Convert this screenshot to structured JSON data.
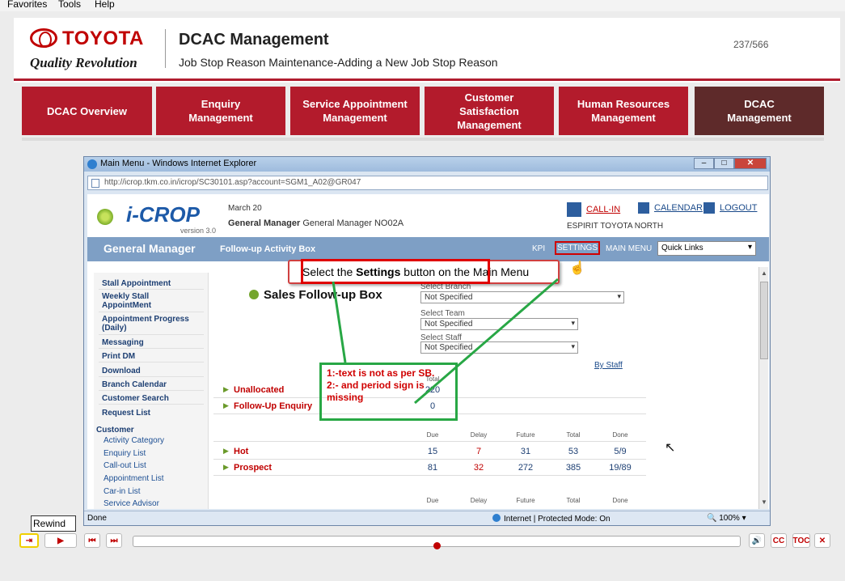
{
  "browser_menu": [
    "Favorites",
    "Tools",
    "Help"
  ],
  "header": {
    "expand_glyph": "»",
    "brand": "TOYOTA",
    "tagline": "Quality Revolution",
    "title": "DCAC Management",
    "subtitle": "Job Stop Reason Maintenance-Adding a New Job Stop Reason",
    "page_counter": "237/566"
  },
  "nav": {
    "tabs": [
      {
        "label": "DCAC Overview"
      },
      {
        "label": "Enquiry Management"
      },
      {
        "label": "Service Appointment Management"
      },
      {
        "label": "Customer Satisfaction Management"
      },
      {
        "label": "Human Resources Management"
      },
      {
        "label": "DCAC Management",
        "active": true
      }
    ]
  },
  "ie": {
    "title": "Main Menu  - Windows Internet Explorer",
    "address": "http://icrop.tkm.co.in/icrop/SC30101.asp?account=SGM1_A02@GR047",
    "status_left": "Done",
    "status_zone": "Internet | Protected Mode: On",
    "zoom": "100%"
  },
  "app": {
    "logo": "i-CROP",
    "version": "version 3.0",
    "date": "March 20",
    "user_role": "General Manager",
    "user_name": "General Manager NO02A",
    "links": {
      "callin": "CALL-IN",
      "calendar": "CALENDAR",
      "logout": "LOGOUT"
    },
    "dealer": "ESPIRIT TOYOTA NORTH",
    "band": {
      "role": "General Manager",
      "screen": "Follow-up Activity Box",
      "kpi": "KPI",
      "settings": "SETTINGS",
      "main_menu": "MAIN MENU",
      "quick_links": "Quick Links"
    },
    "sidebar": {
      "items": [
        "Stall Appointment",
        "Weekly Stall AppointMent",
        "Appointment Progress (Daily)",
        "Messaging",
        "Print DM",
        "Download",
        "Branch Calendar",
        "Customer Search",
        "Request List"
      ],
      "section": "Customer",
      "sub_items": [
        "Activity Category",
        "Enquiry List",
        "Call-out List",
        "Appointment List",
        "Car-in List",
        "Service Advisor"
      ]
    },
    "followup": {
      "title": "Sales Follow-up Box",
      "select_branch_label": "Select Branch",
      "select_branch_value": "Not Specified",
      "select_team_label": "Select Team",
      "select_team_value": "Not Specified",
      "select_staff_label": "Select Staff",
      "select_staff_value": "Not Specified",
      "by_staff": "By Staff",
      "total_header": "Total",
      "unallocated_label": "Unallocated",
      "unallocated_total": "220",
      "followup_enquiry_label": "Follow-Up Enquiry",
      "followup_enquiry_total": "0",
      "headers": [
        "Due",
        "Delay",
        "Future",
        "Total",
        "Done"
      ],
      "hot": {
        "label": "Hot",
        "due": "15",
        "delay": "7",
        "future": "31",
        "total": "53",
        "done": "5/9"
      },
      "prospect": {
        "label": "Prospect",
        "due": "81",
        "delay": "32",
        "future": "272",
        "total": "385",
        "done": "19/89"
      },
      "headers_repeat": [
        "Due",
        "Delay",
        "Future",
        "Total",
        "Done"
      ]
    }
  },
  "callout": {
    "prefix": "Select the ",
    "bold": "Settings",
    "suffix": " button on the Main Menu"
  },
  "review_note": {
    "line1": "1:-text is not as per SB.",
    "line2": "2:- and period sign is",
    "line3": "missing"
  },
  "player": {
    "tooltip": "Rewind",
    "cc": "CC",
    "toc": "TOC",
    "close": "✕",
    "progress": 0.5
  }
}
